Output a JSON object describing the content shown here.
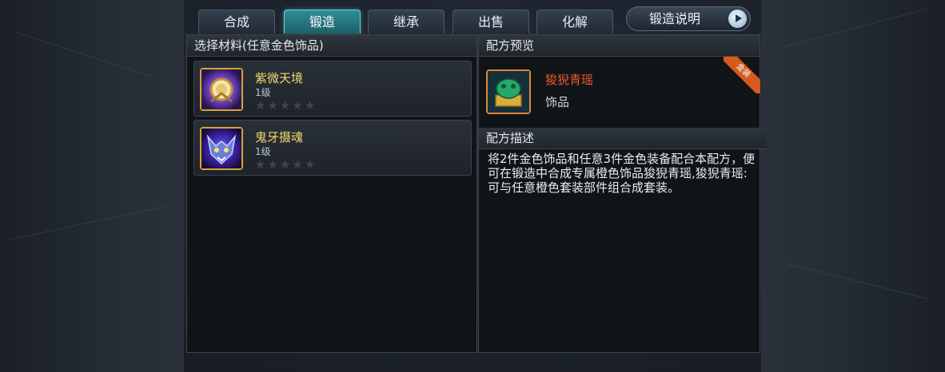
{
  "tabs": [
    {
      "label": "合成",
      "active": false
    },
    {
      "label": "锻造",
      "active": true
    },
    {
      "label": "继承",
      "active": false
    },
    {
      "label": "出售",
      "active": false
    },
    {
      "label": "化解",
      "active": false
    }
  ],
  "help_button": {
    "label": "锻造说明"
  },
  "materials": {
    "header": "选择材料(任意金色饰品)",
    "items": [
      {
        "name": "紫微天境",
        "level": "1级",
        "stars": 0,
        "max_stars": 5,
        "icon": "purple-orb-icon"
      },
      {
        "name": "鬼牙摄魂",
        "level": "1级",
        "stars": 0,
        "max_stars": 5,
        "icon": "demon-mask-icon"
      }
    ]
  },
  "recipe": {
    "header": "配方预览",
    "item_name": "狻猊青瑶",
    "item_type": "饰品",
    "icon": "jade-lion-seal-icon",
    "ribbon": "金装"
  },
  "description": {
    "header": "配方描述",
    "text": "将2件金色饰品和任意3件金色装备配合本配方，便可在锻造中合成专属橙色饰品狻猊青瑶,狻猊青瑶:可与任意橙色套装部件组合成套装。"
  },
  "colors": {
    "active_tab": "#2f8d96",
    "material_name": "#f2d86b",
    "recipe_name": "#f05a2c",
    "gold_frame": "#d7a536",
    "orange_frame": "#e2853b"
  }
}
